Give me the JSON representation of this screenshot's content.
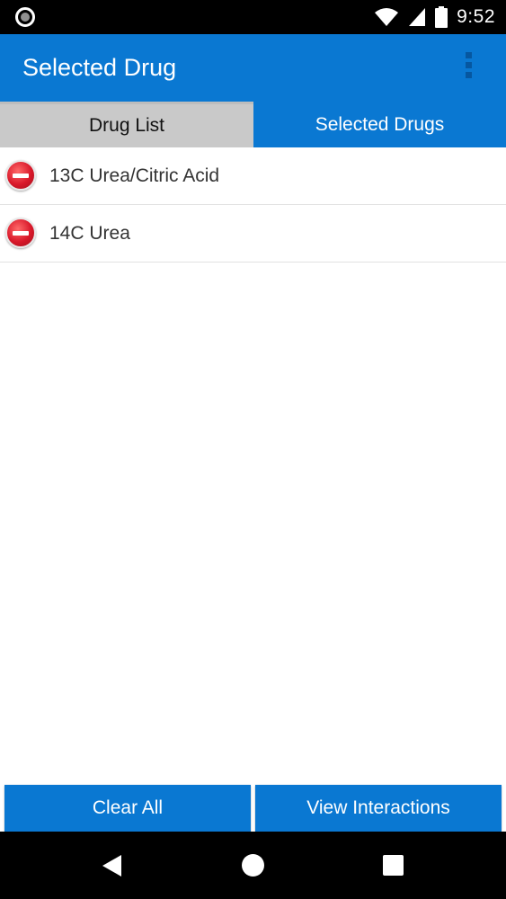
{
  "status_bar": {
    "time": "9:52",
    "icons": [
      "notification-circle-icon",
      "wifi-icon",
      "cellular-signal-icon",
      "battery-icon"
    ]
  },
  "app_bar": {
    "title": "Selected Drug",
    "menu_icon": "overflow-menu-icon"
  },
  "tabs": [
    {
      "label": "Drug List",
      "active": false
    },
    {
      "label": "Selected Drugs",
      "active": true
    }
  ],
  "drugs": [
    {
      "name": "13C Urea/Citric Acid",
      "icon": "remove-icon"
    },
    {
      "name": "14C Urea",
      "icon": "remove-icon"
    }
  ],
  "buttons": {
    "clear_all": "Clear All",
    "view_interactions": "View Interactions"
  },
  "nav_bar": {
    "icons": [
      "back-icon",
      "home-icon",
      "recents-icon"
    ]
  },
  "colors": {
    "primary": "#0a78d2",
    "inactive_tab": "#c9c9c9",
    "remove_red": "#d9182a"
  }
}
